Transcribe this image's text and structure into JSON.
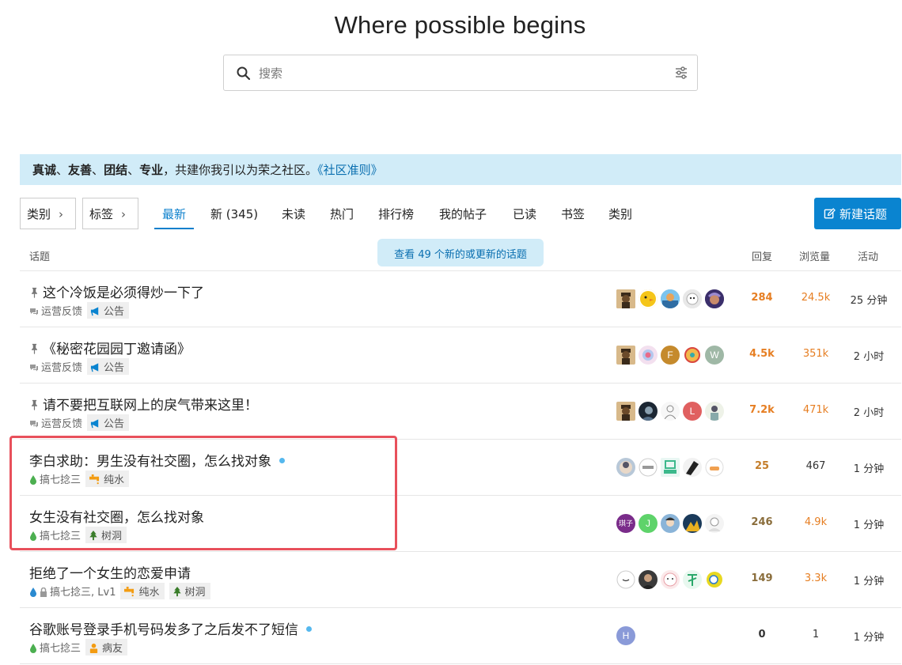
{
  "hero": {
    "title": "Where possible begins"
  },
  "search": {
    "placeholder": "搜索",
    "search_icon": "search-icon",
    "filter_icon": "sliders-icon"
  },
  "banner": {
    "b1": "真诚",
    "sep1": "、",
    "b2": "友善",
    "sep2": "、",
    "b3": "团结",
    "sep3": "、",
    "b4": "专业",
    "rest": "，共建你我引以为荣之社区。",
    "link": "《社区准则》",
    "bg_color": "#d1ecf8"
  },
  "nav": {
    "categories_dropdown": "类别",
    "tags_dropdown": "标签",
    "tabs": [
      "最新",
      "新 (345)",
      "未读",
      "热门",
      "排行榜",
      "我的帖子",
      "已读",
      "书签",
      "类别"
    ],
    "active_tab": "最新",
    "new_topic_button": "新建话题",
    "accent_color": "#0a84d0"
  },
  "list_header": {
    "topic": "话题",
    "replies": "回复",
    "views": "浏览量",
    "activity": "活动",
    "new_topics_notice": "查看 49 个新的或更新的话题"
  },
  "topics": [
    {
      "title": "这个冷饭是必须得炒一下了",
      "pinned": true,
      "unread_dot": false,
      "category": "运营反馈",
      "tags": [
        "公告"
      ],
      "replies": "284",
      "views": "24.5k",
      "activity": "25 分钟",
      "replies_color": "#e67e22",
      "views_color": "#e67e22"
    },
    {
      "title": "《秘密花园园丁邀请函》",
      "pinned": true,
      "unread_dot": false,
      "category": "运营反馈",
      "tags": [
        "公告"
      ],
      "replies": "4.5k",
      "views": "351k",
      "activity": "2 小时",
      "replies_color": "#e67e22",
      "views_color": "#e67e22"
    },
    {
      "title": "请不要把互联网上的戾气带来这里！",
      "pinned": true,
      "unread_dot": false,
      "category": "运营反馈",
      "tags": [
        "公告"
      ],
      "replies": "7.2k",
      "views": "471k",
      "activity": "2 小时",
      "replies_color": "#e67e22",
      "views_color": "#e67e22"
    },
    {
      "title": "李白求助：男生没有社交圈，怎么找对象",
      "pinned": false,
      "unread_dot": true,
      "category": "搞七捻三",
      "tags": [
        "纯水"
      ],
      "replies": "25",
      "views": "467",
      "activity": "1 分钟",
      "replies_color": "#c47d2a",
      "views_color": "#333333"
    },
    {
      "title": "女生没有社交圈，怎么找对象",
      "pinned": false,
      "unread_dot": false,
      "category": "搞七捻三",
      "tags": [
        "树洞"
      ],
      "replies": "246",
      "views": "4.9k",
      "activity": "1 分钟",
      "replies_color": "#8a6d3b",
      "views_color": "#e67e22"
    },
    {
      "title": "拒绝了一个女生的恋爱申请",
      "pinned": false,
      "unread_dot": false,
      "category": "搞七捻三, Lv1",
      "tags": [
        "纯水",
        "树洞"
      ],
      "replies": "149",
      "views": "3.3k",
      "activity": "1 分钟",
      "replies_color": "#8a6d3b",
      "views_color": "#e67e22"
    },
    {
      "title": "谷歌账号登录手机号码发多了之后发不了短信",
      "pinned": false,
      "unread_dot": true,
      "category": "搞七捻三",
      "tags": [
        "病友"
      ],
      "replies": "0",
      "views": "1",
      "activity": "1 分钟",
      "replies_color": "#333333",
      "views_color": "#333333"
    }
  ],
  "avatar_letters": {
    "r1": [
      "",
      "",
      "",
      "",
      ""
    ],
    "r2": [
      "",
      "",
      "F",
      "",
      "W"
    ],
    "r3": [
      "",
      "",
      "",
      "L",
      ""
    ],
    "r4": [
      "",
      "",
      "",
      "",
      ""
    ],
    "r5": [
      "琪子",
      "J",
      "",
      "",
      ""
    ],
    "r6": [
      "",
      "",
      "",
      "",
      ""
    ],
    "r7": [
      "H"
    ]
  }
}
